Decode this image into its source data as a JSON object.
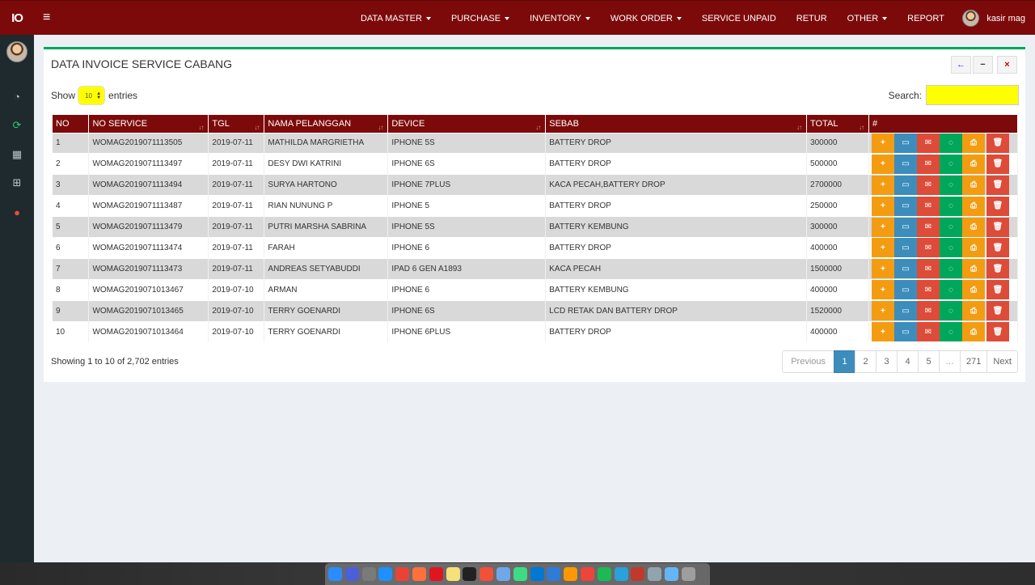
{
  "app": {
    "logo_text": "IO",
    "user_name": "kasir mag"
  },
  "nav": [
    {
      "label": "DATA MASTER",
      "dropdown": true
    },
    {
      "label": "PURCHASE",
      "dropdown": true
    },
    {
      "label": "INVENTORY",
      "dropdown": true
    },
    {
      "label": "WORK ORDER",
      "dropdown": true
    },
    {
      "label": "SERVICE UNPAID",
      "dropdown": false
    },
    {
      "label": "RETUR",
      "dropdown": false
    },
    {
      "label": "OTHER",
      "dropdown": true
    },
    {
      "label": "REPORT",
      "dropdown": false
    }
  ],
  "sidebar_icons": [
    "dashboard-icon",
    "refresh-icon",
    "calendar-icon",
    "grid-icon",
    "user-icon"
  ],
  "box": {
    "title": "DATA INVOICE SERVICE CABANG",
    "tools": [
      "back-arrow-icon",
      "minimize-icon",
      "close-icon"
    ]
  },
  "length": {
    "show_label": "Show",
    "value": "10",
    "entries_label": "entries"
  },
  "search": {
    "label": "Search:",
    "value": ""
  },
  "table": {
    "headers": [
      "NO",
      "NO SERVICE",
      "TGL",
      "NAMA PELANGGAN",
      "DEVICE",
      "SEBAB",
      "TOTAL",
      "#"
    ],
    "rows": [
      {
        "no": "1",
        "service": "WOMAG2019071113505",
        "tgl": "2019-07-11",
        "nama": "MATHILDA MARGRIETHA",
        "device": "IPHONE 5S",
        "sebab": "BATTERY DROP",
        "total": "300000"
      },
      {
        "no": "2",
        "service": "WOMAG2019071113497",
        "tgl": "2019-07-11",
        "nama": "DESY DWI KATRINI",
        "device": "IPHONE 6S",
        "sebab": "BATTERY DROP",
        "total": "500000"
      },
      {
        "no": "3",
        "service": "WOMAG2019071113494",
        "tgl": "2019-07-11",
        "nama": "SURYA HARTONO",
        "device": "IPHONE 7PLUS",
        "sebab": "KACA PECAH,BATTERY DROP",
        "total": "2700000"
      },
      {
        "no": "4",
        "service": "WOMAG2019071113487",
        "tgl": "2019-07-11",
        "nama": "RIAN NUNUNG P",
        "device": "IPHONE 5",
        "sebab": "BATTERY DROP",
        "total": "250000"
      },
      {
        "no": "5",
        "service": "WOMAG2019071113479",
        "tgl": "2019-07-11",
        "nama": "PUTRI MARSHA SABRINA",
        "device": "IPHONE 5S",
        "sebab": "BATTERY KEMBUNG",
        "total": "300000"
      },
      {
        "no": "6",
        "service": "WOMAG2019071113474",
        "tgl": "2019-07-11",
        "nama": "FARAH",
        "device": "IPHONE 6",
        "sebab": "BATTERY DROP",
        "total": "400000"
      },
      {
        "no": "7",
        "service": "WOMAG2019071113473",
        "tgl": "2019-07-11",
        "nama": "ANDREAS SETYABUDDI",
        "device": "IPAD 6 GEN A1893",
        "sebab": "KACA PECAH",
        "total": "1500000"
      },
      {
        "no": "8",
        "service": "WOMAG2019071013467",
        "tgl": "2019-07-10",
        "nama": "ARMAN",
        "device": "IPHONE 6",
        "sebab": "BATTERY KEMBUNG",
        "total": "400000"
      },
      {
        "no": "9",
        "service": "WOMAG2019071013465",
        "tgl": "2019-07-10",
        "nama": "TERRY GOENARDI",
        "device": "IPHONE 6S",
        "sebab": "LCD RETAK DAN BATTERY DROP",
        "total": "1520000"
      },
      {
        "no": "10",
        "service": "WOMAG2019071013464",
        "tgl": "2019-07-10",
        "nama": "TERRY GOENARDI",
        "device": "IPHONE 6PLUS",
        "sebab": "BATTERY DROP",
        "total": "400000"
      }
    ],
    "actions": [
      {
        "name": "add-button",
        "icon": "plus-icon",
        "glyph": "+",
        "cls": "a-add"
      },
      {
        "name": "view-button",
        "icon": "laptop-icon",
        "glyph": "▭",
        "cls": "a-view"
      },
      {
        "name": "email-button",
        "icon": "envelope-icon",
        "glyph": "✉",
        "cls": "a-mail"
      },
      {
        "name": "whatsapp-button",
        "icon": "whatsapp-icon",
        "glyph": "◌",
        "cls": "a-wa"
      },
      {
        "name": "print-button",
        "icon": "print-icon",
        "glyph": "⎙",
        "cls": "a-print"
      },
      {
        "name": "delete-button",
        "icon": "trash-icon",
        "glyph": "🗑",
        "cls": "a-del"
      }
    ]
  },
  "footer": {
    "info": "Showing 1 to 10 of 2,702 entries"
  },
  "pagination": [
    {
      "label": "Previous",
      "state": "disabled",
      "kind": "prev"
    },
    {
      "label": "1",
      "state": "active",
      "kind": "page"
    },
    {
      "label": "2",
      "state": "",
      "kind": "page"
    },
    {
      "label": "3",
      "state": "",
      "kind": "page"
    },
    {
      "label": "4",
      "state": "",
      "kind": "page"
    },
    {
      "label": "5",
      "state": "",
      "kind": "page"
    },
    {
      "label": "…",
      "state": "disabled",
      "kind": "ellipsis"
    },
    {
      "label": "271",
      "state": "",
      "kind": "page"
    },
    {
      "label": "Next",
      "state": "",
      "kind": "next"
    }
  ],
  "colors": {
    "topbar": "#7d0a0a",
    "box_accent": "#00a65a",
    "highlight": "#ffff00",
    "active_page": "#3c8dbc"
  },
  "dock_icons": [
    "finder-icon",
    "siri-icon",
    "launchpad-icon",
    "safari-icon",
    "chrome-icon",
    "firefox-icon",
    "opera-icon",
    "notes-icon",
    "terminal-icon",
    "swift-icon",
    "preview-icon",
    "android-studio-icon",
    "vscode-icon",
    "xcode-icon",
    "sublime-icon",
    "anydesk-icon",
    "spotify-icon",
    "telegram-icon",
    "elite-icon",
    "scanner-icon",
    "folder-icon",
    "trash-icon"
  ]
}
